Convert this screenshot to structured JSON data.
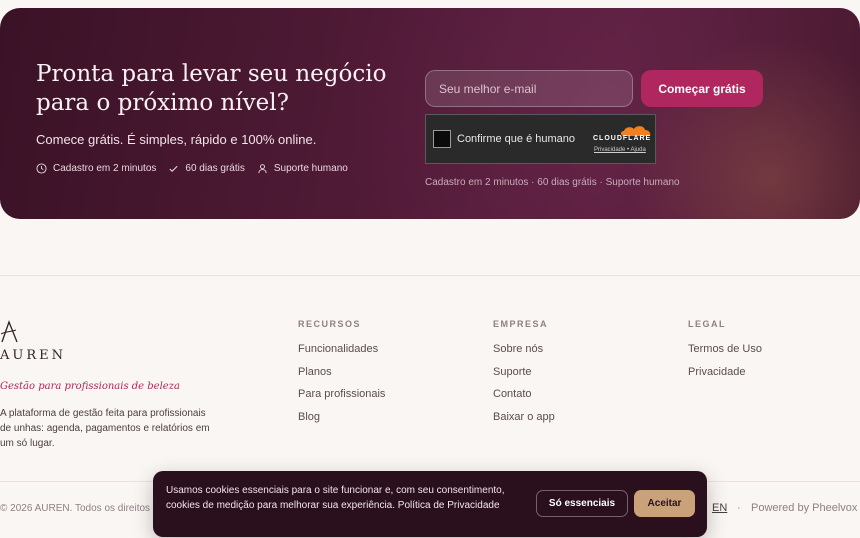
{
  "hero": {
    "title": "Pronta para levar seu negócio para o próximo nível?",
    "subtitle": "Comece grátis. É simples, rápido e 100% online.",
    "features": [
      "Cadastro em 2 minutos",
      "60 dias grátis",
      "Suporte humano"
    ],
    "email_placeholder": "Seu melhor e-mail",
    "cta_label": "Começar grátis",
    "note": "Cadastro em 2 minutos · 60 dias grátis · Suporte humano",
    "captcha": {
      "label": "Confirme que é humano",
      "brand": "CLOUDFLARE",
      "links": "Privacidade • Ajuda"
    }
  },
  "footer": {
    "logo_text": "AUREN",
    "tagline": "Gestão para profissionais de beleza",
    "description": "A plataforma de gestão feita para profissionais de unhas: agenda, pagamentos e relatórios em um só lugar.",
    "columns": [
      {
        "heading": "RECURSOS",
        "links": [
          "Funcionalidades",
          "Planos",
          "Para profissionais",
          "Blog"
        ]
      },
      {
        "heading": "EMPRESA",
        "links": [
          "Sobre nós",
          "Suporte",
          "Contato",
          "Baixar o app"
        ]
      },
      {
        "heading": "LEGAL",
        "links": [
          "Termos de Uso",
          "Privacidade"
        ]
      }
    ],
    "copyright": "© 2026 AUREN. Todos os direitos",
    "lang": "EN",
    "separator": "·",
    "powered": "Powered by Pheelvox"
  },
  "cookie": {
    "text": "Usamos cookies essenciais para o site funcionar e, com seu consentimento, cookies de medição para melhorar sua experiência. Política de Privacidade",
    "essential_label": "Só essenciais",
    "accept_label": "Aceitar"
  },
  "colors": {
    "accent": "#b0275f",
    "hero_bg": "#4e1a35",
    "cookie_bg": "#2a0f1d",
    "accept_bg": "#caa27a"
  }
}
